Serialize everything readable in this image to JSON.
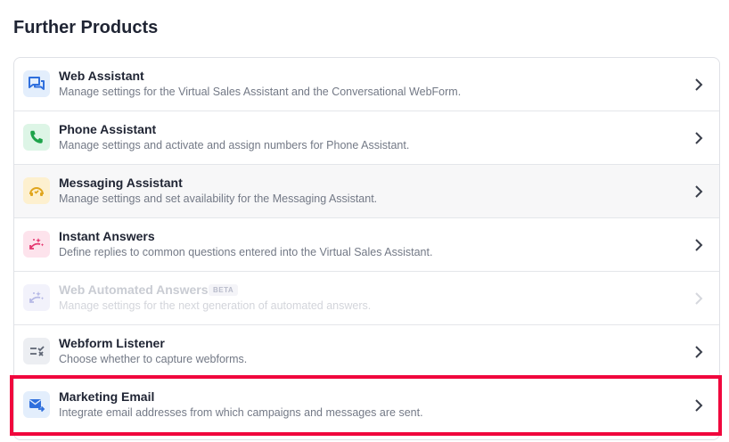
{
  "page": {
    "title": "Further Products"
  },
  "products": [
    {
      "name": "Web Assistant",
      "description": "Manage settings for the Virtual Sales Assistant and the Conversational WebForm.",
      "icon": "chat-bubbles-icon",
      "color": "#2f6fdd",
      "bg": "#e3eefc"
    },
    {
      "name": "Phone Assistant",
      "description": "Manage settings and activate and assign numbers for Phone Assistant.",
      "icon": "phone-icon",
      "color": "#1ea34a",
      "bg": "#ddf5e6"
    },
    {
      "name": "Messaging Assistant",
      "description": "Manage settings and set availability for the Messaging Assistant.",
      "icon": "messaging-icon",
      "color": "#e0a51d",
      "bg": "#fdf0cf"
    },
    {
      "name": "Instant Answers",
      "description": "Define replies to common questions entered into the Virtual Sales Assistant.",
      "icon": "sparkle-arrow-icon",
      "color": "#e4366f",
      "bg": "#fde3ec"
    },
    {
      "name": "Web Automated Answers",
      "badge": "BETA",
      "description": "Manage settings for the next generation of automated answers.",
      "icon": "sparkle-arrow-icon",
      "color": "#b6b9e6",
      "bg": "#f2f2fb",
      "disabled": true
    },
    {
      "name": "Webform Listener",
      "description": "Choose whether to capture webforms.",
      "icon": "checklist-icon",
      "color": "#5d6473",
      "bg": "#eceef2"
    },
    {
      "name": "Marketing Email",
      "description": "Integrate email addresses from which campaigns and messages are sent.",
      "icon": "email-send-icon",
      "color": "#2f6fdd",
      "bg": "#e3eefc",
      "highlighted": true
    }
  ],
  "highlight_color": "#f0073d"
}
